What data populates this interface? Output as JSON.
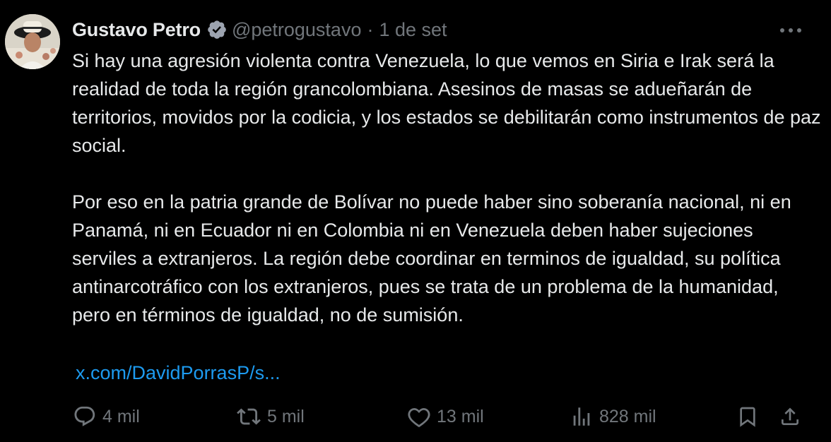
{
  "author": {
    "name": "Gustavo Petro",
    "handle": "@petrogustavo",
    "separator": "·",
    "date": "1 de set"
  },
  "tweet": {
    "paragraphs": [
      "Si hay una agresión violenta contra Venezuela, lo que vemos en Siria e Irak será la realidad de toda la región grancolombiana. Asesinos de masas se adueñarán de territorios, movidos por la codicia, y los estados se debilitarán como instrumentos de paz social.",
      "Por eso en la patria grande de Bolívar no puede haber sino soberanía nacional, ni en Panamá, ni en Ecuador ni en Colombia ni en Venezuela deben haber sujeciones serviles a extranjeros. La región debe coordinar en terminos de igualdad, su política antinarcotráfico con los extranjeros, pues se trata de un problema de la humanidad, pero en términos de igualdad, no de sumisión."
    ],
    "link": "x.com/DavidPorrasP/s..."
  },
  "actions": {
    "replies": "4 mil",
    "reposts": "5 mil",
    "likes": "13 mil",
    "views": "828 mil"
  },
  "icons": {
    "verified": "verified-badge-icon",
    "more": "more-options-icon",
    "reply": "reply-icon",
    "repost": "repost-icon",
    "like": "heart-icon",
    "views": "views-chart-icon",
    "bookmark": "bookmark-icon",
    "share": "share-icon"
  },
  "colors": {
    "background": "#000000",
    "text": "#e7e9ea",
    "secondary": "#71767b",
    "link": "#1d9bf0"
  }
}
